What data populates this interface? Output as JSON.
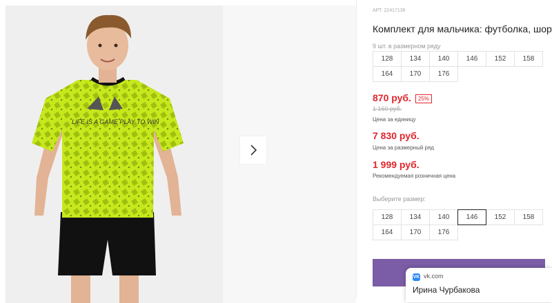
{
  "product": {
    "sku": "АРТ. 22417136",
    "title": "Комплект для мальчика: футболка, шорты",
    "series_note": "9 шт. в размерном ряду",
    "series_sizes": [
      "128",
      "134",
      "140",
      "146",
      "152",
      "158",
      "164",
      "170",
      "176"
    ],
    "price": "870 руб.",
    "discount": "25%",
    "old_price": "1 160 руб.",
    "price_caption": "Цена за единицу",
    "series_price": "7 830 руб.",
    "series_price_caption": "Цена за размерный ряд",
    "retail_price": "1 999 руб.",
    "retail_price_caption": "Рекомендуемая розничная цена",
    "size_label": "Выберите размер:",
    "selected_size": "146"
  },
  "gallery": {
    "next_icon": "chevron-right-icon",
    "shirt_print": "LIFE IS A GAME PLAY TO WIN"
  },
  "vk_popup": {
    "domain": "vk.com",
    "name": "Ирина Чурбакова"
  },
  "colors": {
    "price": "#e0262c",
    "buy_button": "#7b5ca6",
    "shirt": "#c6e81c",
    "vk": "#2787f5"
  }
}
